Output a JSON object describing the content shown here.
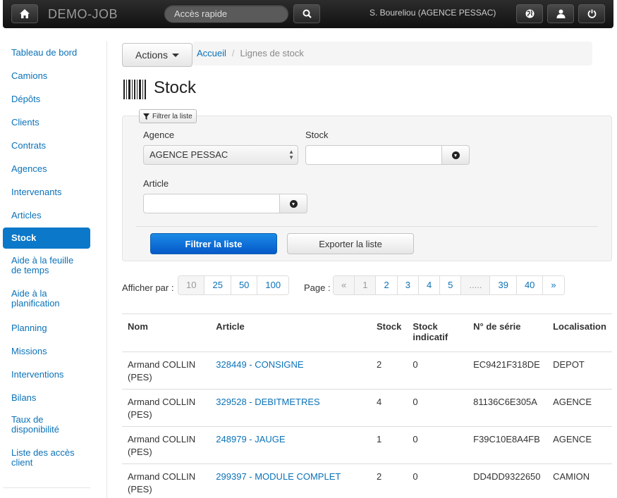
{
  "navbar": {
    "brand": "DEMO-JOB",
    "search_placeholder": "Accès rapide",
    "user": "S. Boureliou (AGENCE PESSAC)"
  },
  "sidebar": {
    "items": [
      {
        "label": "Tableau de bord"
      },
      {
        "label": "Camions"
      },
      {
        "label": "Dépôts"
      },
      {
        "label": "Clients"
      },
      {
        "label": "Contrats"
      },
      {
        "label": "Agences"
      },
      {
        "label": "Intervenants"
      },
      {
        "label": "Articles"
      },
      {
        "label": "Stock"
      },
      {
        "label": "Aide à la feuille de temps"
      },
      {
        "label": "Aide à la planification"
      },
      {
        "label": "Planning"
      },
      {
        "label": "Missions"
      },
      {
        "label": "Interventions"
      },
      {
        "label": "Bilans"
      },
      {
        "label": "Taux de disponibilité"
      },
      {
        "label": "Liste des accès client"
      }
    ]
  },
  "actions_label": "Actions",
  "breadcrumb": {
    "home": "Accueil",
    "current": "Lignes de stock"
  },
  "page_title": "Stock",
  "filter": {
    "tag": "Filtrer la liste",
    "agence_label": "Agence",
    "agence_value": "AGENCE PESSAC",
    "stock_label": "Stock",
    "article_label": "Article",
    "submit": "Filtrer la liste",
    "export": "Exporter la liste"
  },
  "pagination": {
    "per_page_label": "Afficher par :",
    "per_page_options": [
      "10",
      "25",
      "50",
      "100"
    ],
    "page_label": "Page :",
    "pages": [
      "«",
      "1",
      "2",
      "3",
      "4",
      "5",
      ".....",
      "39",
      "40",
      "»"
    ]
  },
  "table": {
    "headers": [
      "Nom",
      "Article",
      "Stock",
      "Stock indicatif",
      "N° de série",
      "Localisation"
    ],
    "rows": [
      {
        "nom": "Armand COLLIN (PES)",
        "article": "328449 - CONSIGNE",
        "stock": "2",
        "indicatif": "0",
        "serie": "EC9421F318DE",
        "loc": "DEPOT"
      },
      {
        "nom": "Armand COLLIN (PES)",
        "article": "329528 - DEBITMETRES",
        "stock": "4",
        "indicatif": "0",
        "serie": "81136C6E305A",
        "loc": "AGENCE"
      },
      {
        "nom": "Armand COLLIN (PES)",
        "article": "248979 - JAUGE",
        "stock": "1",
        "indicatif": "0",
        "serie": "F39C10E8A4FB",
        "loc": "AGENCE"
      },
      {
        "nom": "Armand COLLIN (PES)",
        "article": "299397 - MODULE COMPLET",
        "stock": "2",
        "indicatif": "0",
        "serie": "DD4DD9322650",
        "loc": "CAMION"
      }
    ]
  }
}
